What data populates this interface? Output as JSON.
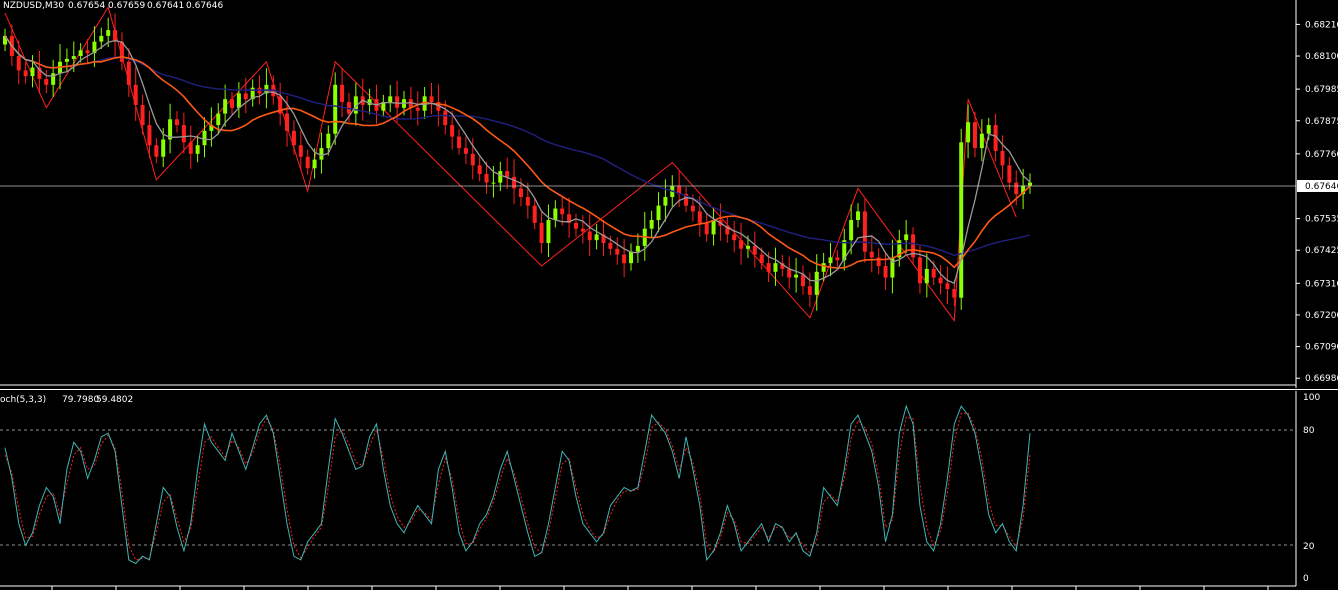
{
  "chart_data": [
    {
      "type": "candlestick",
      "symbol": "NZDUSD,M30",
      "ohlc_readout": [
        "0.67654",
        "0.67659",
        "0.67641",
        "0.67646"
      ],
      "current_price": "0.67646",
      "y_ticks": [
        "0.68210",
        "0.68100",
        "0.67985",
        "0.67875",
        "0.67760",
        "0.67535",
        "0.67425",
        "0.67310",
        "0.67200",
        "0.67090",
        "0.66980"
      ],
      "ylim": [
        0.6696,
        0.6826
      ],
      "bar_count": 150,
      "closes": [
        0.6817,
        0.681,
        0.6805,
        0.6803,
        0.6806,
        0.6802,
        0.68,
        0.6804,
        0.6808,
        0.6809,
        0.681,
        0.6812,
        0.6811,
        0.6815,
        0.6817,
        0.6819,
        0.6815,
        0.6808,
        0.68,
        0.6793,
        0.6786,
        0.6779,
        0.6775,
        0.6781,
        0.6788,
        0.6786,
        0.678,
        0.6776,
        0.6779,
        0.6784,
        0.6786,
        0.679,
        0.6795,
        0.6792,
        0.6797,
        0.6795,
        0.6799,
        0.6797,
        0.68,
        0.6796,
        0.679,
        0.6784,
        0.6779,
        0.6775,
        0.6771,
        0.6774,
        0.6778,
        0.6783,
        0.68,
        0.6794,
        0.679,
        0.6796,
        0.6793,
        0.6795,
        0.6791,
        0.6794,
        0.6796,
        0.6792,
        0.6795,
        0.6792,
        0.6791,
        0.6796,
        0.6794,
        0.6791,
        0.6786,
        0.6782,
        0.6778,
        0.6776,
        0.6772,
        0.6769,
        0.6766,
        0.6766,
        0.677,
        0.6768,
        0.6764,
        0.6761,
        0.6758,
        0.6752,
        0.6745,
        0.6753,
        0.6757,
        0.6755,
        0.6752,
        0.675,
        0.6749,
        0.6746,
        0.6748,
        0.6745,
        0.6743,
        0.6741,
        0.6738,
        0.6742,
        0.6744,
        0.675,
        0.6753,
        0.6758,
        0.6761,
        0.6765,
        0.6762,
        0.6758,
        0.6756,
        0.6752,
        0.6748,
        0.6753,
        0.6751,
        0.6748,
        0.6746,
        0.6743,
        0.6744,
        0.6741,
        0.6738,
        0.6735,
        0.6738,
        0.6736,
        0.6733,
        0.6734,
        0.673,
        0.6727,
        0.6735,
        0.6738,
        0.674,
        0.6739,
        0.6746,
        0.6753,
        0.6756,
        0.6742,
        0.674,
        0.6737,
        0.6733,
        0.674,
        0.6746,
        0.6748,
        0.674,
        0.6731,
        0.6736,
        0.6733,
        0.6731,
        0.6729,
        0.6726,
        0.678,
        0.6787,
        0.6778,
        0.6783,
        0.6786,
        0.6777,
        0.6772,
        0.6766,
        0.6762,
        0.6765,
        0.6766
      ]
    },
    {
      "type": "line",
      "indicator_label": "och(5,3,3)",
      "main_value": "79.7980",
      "signal_value": "59.4802",
      "y_ticks": [
        "100",
        "80",
        "20",
        "0"
      ],
      "levels": [
        80,
        20
      ],
      "ylim": [
        0,
        100
      ],
      "series": [
        {
          "color": "#3fb6b6",
          "values": [
            72,
            55,
            30,
            18,
            25,
            40,
            50,
            45,
            30,
            60,
            75,
            70,
            55,
            65,
            78,
            80,
            70,
            40,
            10,
            8,
            12,
            10,
            30,
            50,
            45,
            28,
            15,
            30,
            60,
            85,
            75,
            70,
            65,
            80,
            70,
            60,
            72,
            85,
            90,
            80,
            55,
            30,
            12,
            10,
            20,
            25,
            30,
            60,
            88,
            80,
            70,
            60,
            62,
            78,
            85,
            60,
            40,
            30,
            25,
            33,
            40,
            35,
            30,
            60,
            70,
            50,
            25,
            15,
            20,
            30,
            35,
            45,
            60,
            70,
            55,
            40,
            25,
            12,
            14,
            30,
            50,
            70,
            65,
            45,
            30,
            25,
            20,
            25,
            40,
            45,
            50,
            48,
            50,
            70,
            90,
            85,
            80,
            70,
            55,
            78,
            60,
            40,
            10,
            15,
            25,
            40,
            30,
            15,
            20,
            25,
            30,
            20,
            30,
            28,
            20,
            25,
            15,
            12,
            25,
            50,
            45,
            40,
            60,
            85,
            90,
            80,
            70,
            50,
            20,
            35,
            80,
            95,
            85,
            40,
            20,
            15,
            30,
            55,
            85,
            95,
            90,
            80,
            60,
            35,
            25,
            30,
            20,
            15,
            40,
            80
          ]
        },
        {
          "color": "#ff2020",
          "values": [
            68,
            58,
            38,
            22,
            23,
            35,
            45,
            47,
            35,
            52,
            68,
            72,
            60,
            62,
            74,
            79,
            72,
            48,
            18,
            10,
            11,
            11,
            25,
            42,
            46,
            33,
            20,
            27,
            50,
            75,
            78,
            72,
            67,
            76,
            72,
            63,
            69,
            81,
            88,
            82,
            62,
            38,
            18,
            11,
            17,
            23,
            28,
            50,
            78,
            82,
            74,
            64,
            62,
            73,
            82,
            66,
            46,
            34,
            28,
            31,
            38,
            36,
            32,
            52,
            66,
            55,
            32,
            19,
            19,
            27,
            33,
            42,
            55,
            66,
            58,
            45,
            30,
            17,
            14,
            25,
            44,
            63,
            66,
            50,
            35,
            27,
            22,
            24,
            35,
            43,
            48,
            48,
            49,
            63,
            83,
            86,
            82,
            73,
            60,
            72,
            64,
            46,
            18,
            14,
            22,
            36,
            32,
            20,
            19,
            23,
            28,
            22,
            28,
            28,
            22,
            24,
            18,
            14,
            21,
            42,
            46,
            42,
            55,
            77,
            87,
            83,
            74,
            56,
            28,
            32,
            68,
            89,
            88,
            52,
            28,
            18,
            26,
            47,
            76,
            91,
            91,
            83,
            66,
            42,
            29,
            29,
            23,
            17,
            33,
            68
          ]
        }
      ]
    }
  ]
}
